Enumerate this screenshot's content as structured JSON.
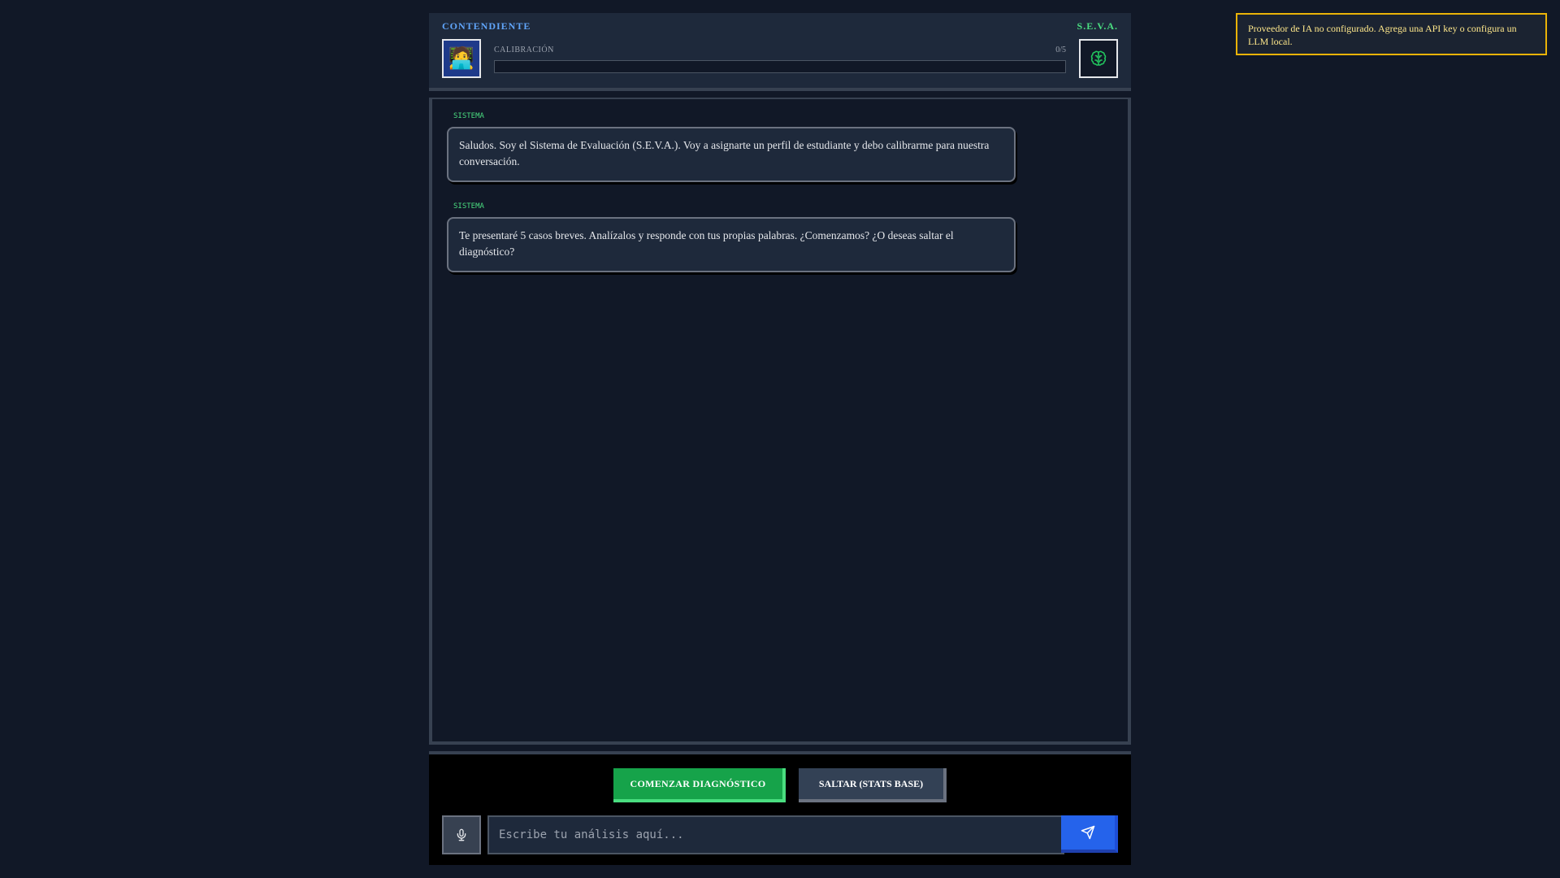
{
  "toast": {
    "message": "Proveedor de IA no configurado. Agrega una API key o configura un LLM local."
  },
  "header": {
    "player_label": "CONTENDIENTE",
    "system_label": "S.E.V.A.",
    "avatar_emoji": "🧑‍💻",
    "calibration_label": "CALIBRACIÓN",
    "calibration_count": "0/5",
    "calibration_progress": 0,
    "brain_icon": "brain-icon"
  },
  "chat": {
    "messages": [
      {
        "sender": "SISTEMA",
        "text": "Saludos. Soy el Sistema de Evaluación (S.E.V.A.). Voy a asignarte un perfil de estudiante y debo calibrarme para nuestra conversación."
      },
      {
        "sender": "SISTEMA",
        "text": "Te presentaré 5 casos breves. Analízalos y responde con tus propias palabras. ¿Comenzamos? ¿O deseas saltar el diagnóstico?"
      }
    ]
  },
  "footer": {
    "start_label": "COMENZAR DIAGNÓSTICO",
    "skip_label": "SALTAR (STATS BASE)",
    "input_placeholder": "Escribe tu análisis aquí...",
    "input_value": "",
    "mic_icon": "microphone-icon",
    "send_icon": "send-icon"
  },
  "colors": {
    "background": "#111827",
    "panel": "#1e293b",
    "player_accent": "#60a5fa",
    "system_accent": "#4ade80",
    "start_button": "#16a34a",
    "send_button": "#2563eb",
    "toast_border": "#eab308"
  }
}
